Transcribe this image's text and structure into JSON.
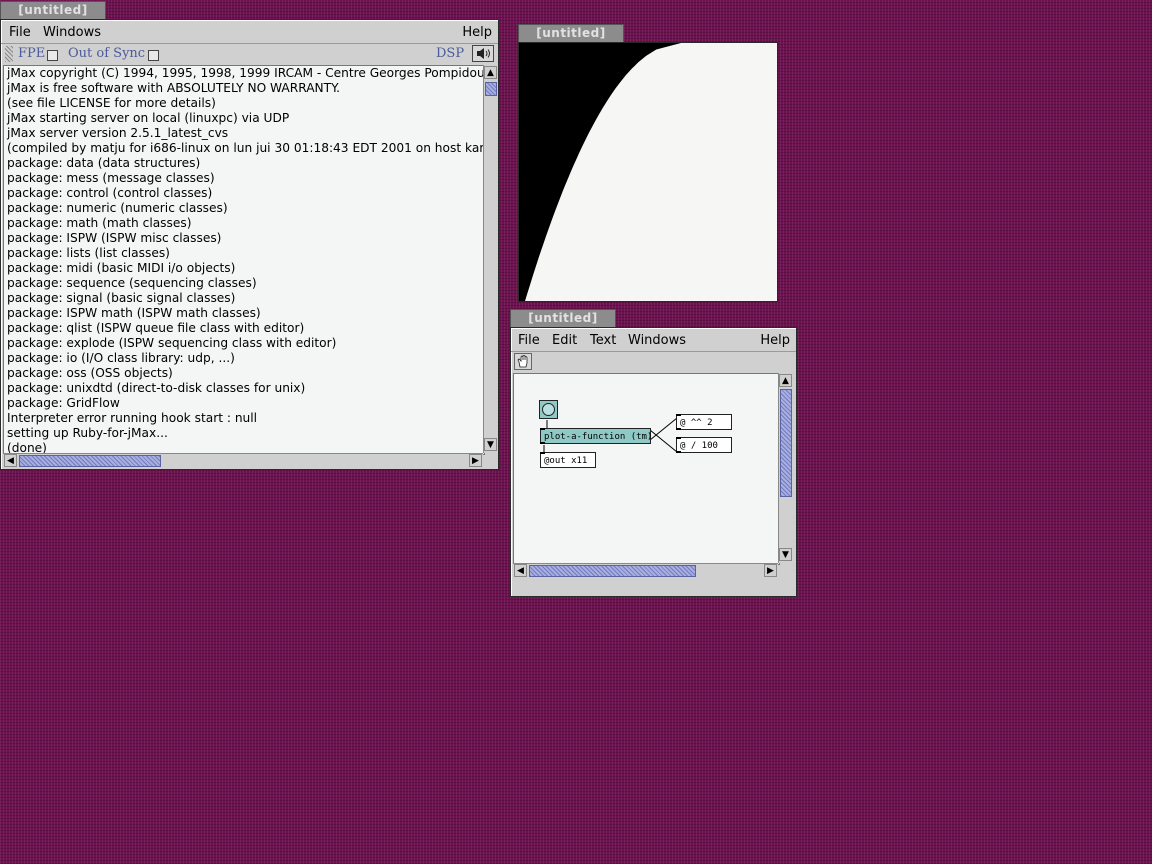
{
  "console_window": {
    "title": "[untitled]",
    "menu": {
      "file": "File",
      "windows": "Windows",
      "help": "Help"
    },
    "toolbar": {
      "fpe": "FPE",
      "out_of_sync": "Out of Sync",
      "dsp": "DSP"
    },
    "lines": [
      "jMax copyright (C) 1994, 1995, 1998, 1999 IRCAM - Centre Georges Pompidou",
      "jMax is free software with ABSOLUTELY NO WARRANTY.",
      "(see file LICENSE for more details)",
      "jMax starting server on local (linuxpc) via UDP",
      "jMax server version 2.5.1_latest_cvs",
      "(compiled by matju for i686-linux on lun jui 30 01:18:43 EDT 2001 on host karel",
      "package: data (data structures)",
      "package: mess (message classes)",
      "package: control (control classes)",
      "package: numeric (numeric classes)",
      "package: math (math classes)",
      "package: ISPW (ISPW misc classes)",
      "package: lists (list classes)",
      "package: midi (basic MIDI i/o objects)",
      "package: sequence (sequencing classes)",
      "package: signal (basic signal classes)",
      "package: ISPW math (ISPW math classes)",
      "package: qlist (ISPW queue file class with editor)",
      "package: explode (ISPW sequencing class with editor)",
      "package: io (I/O class library: udp, ...)",
      "package: oss (OSS objects)",
      "package: unixdtd (direct-to-disk classes for unix)",
      "package: GridFlow",
      "Interpreter error running hook start : null",
      "setting up Ruby-for-jMax...",
      "(done)"
    ]
  },
  "plot_window": {
    "title": "[untitled]"
  },
  "patch_window": {
    "title": "[untitled]",
    "menu": {
      "file": "File",
      "edit": "Edit",
      "text": "Text",
      "windows": "Windows",
      "help": "Help"
    },
    "objects": {
      "plot": "plot-a-function (tm)",
      "pow": "@ ^^ 2",
      "div": "@ / 100",
      "out": "@out x11"
    }
  }
}
